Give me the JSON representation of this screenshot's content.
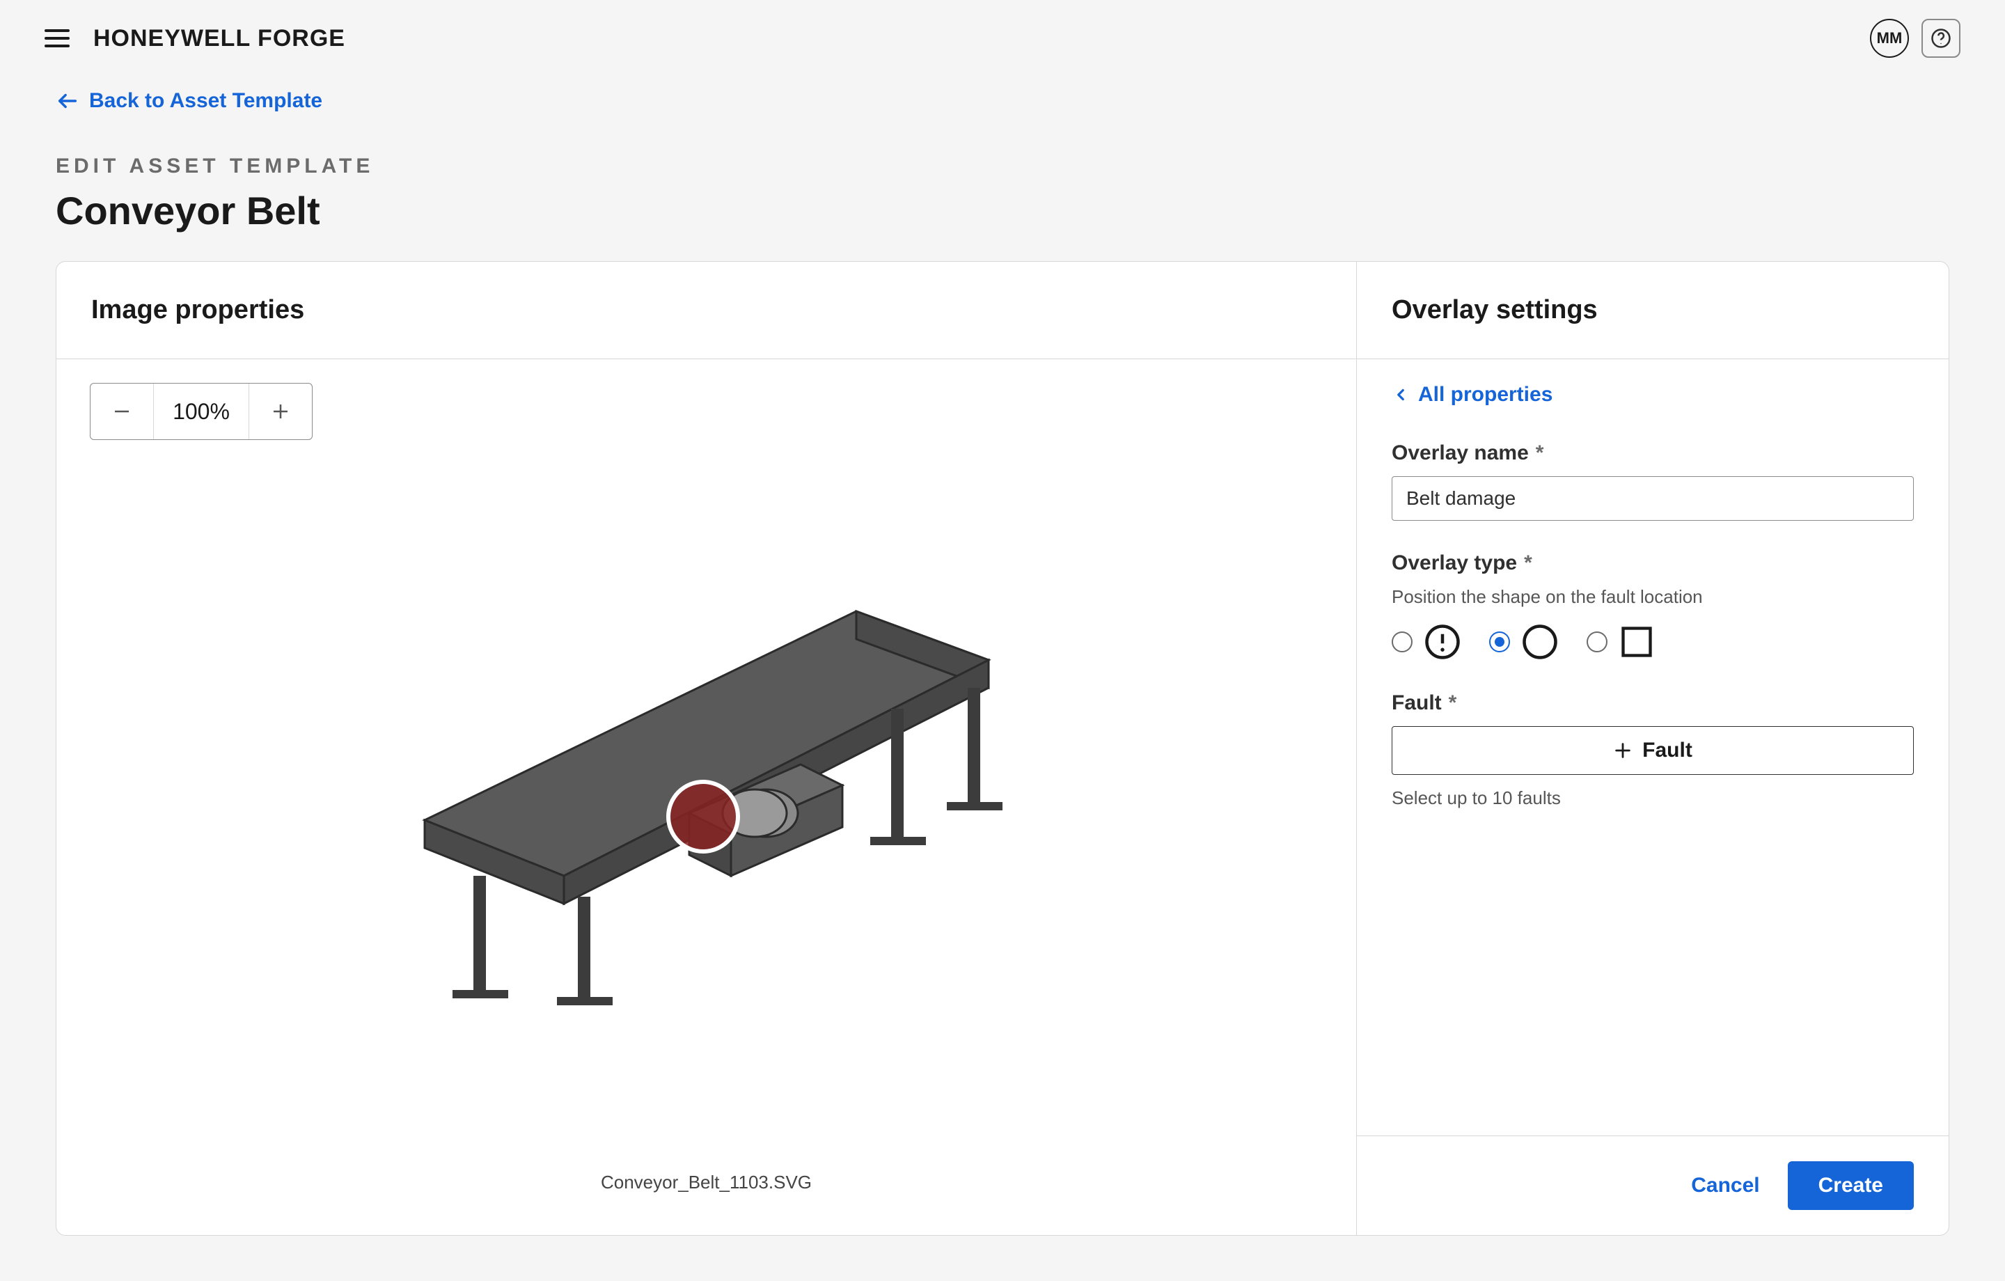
{
  "header": {
    "brand": "HONEYWELL FORGE",
    "user_initials": "MM"
  },
  "nav": {
    "back_label": "Back to Asset Template"
  },
  "page": {
    "eyebrow": "EDIT ASSET TEMPLATE",
    "title": "Conveyor Belt"
  },
  "panels": {
    "image_properties_title": "Image properties",
    "overlay_settings_title": "Overlay settings"
  },
  "zoom": {
    "value": "100%"
  },
  "image": {
    "filename": "Conveyor_Belt_1103.SVG"
  },
  "overlay": {
    "all_properties_label": "All properties",
    "name_label": "Overlay name",
    "name_value": "Belt damage",
    "type_label": "Overlay type",
    "type_hint": "Position the shape on the fault location",
    "fault_label": "Fault",
    "add_fault_label": "Fault",
    "fault_hint": "Select up to 10 faults",
    "required": "*"
  },
  "overlay_type_options": [
    {
      "id": "alert-circle",
      "selected": false
    },
    {
      "id": "circle",
      "selected": true
    },
    {
      "id": "square",
      "selected": false
    }
  ],
  "buttons": {
    "cancel": "Cancel",
    "create": "Create"
  }
}
